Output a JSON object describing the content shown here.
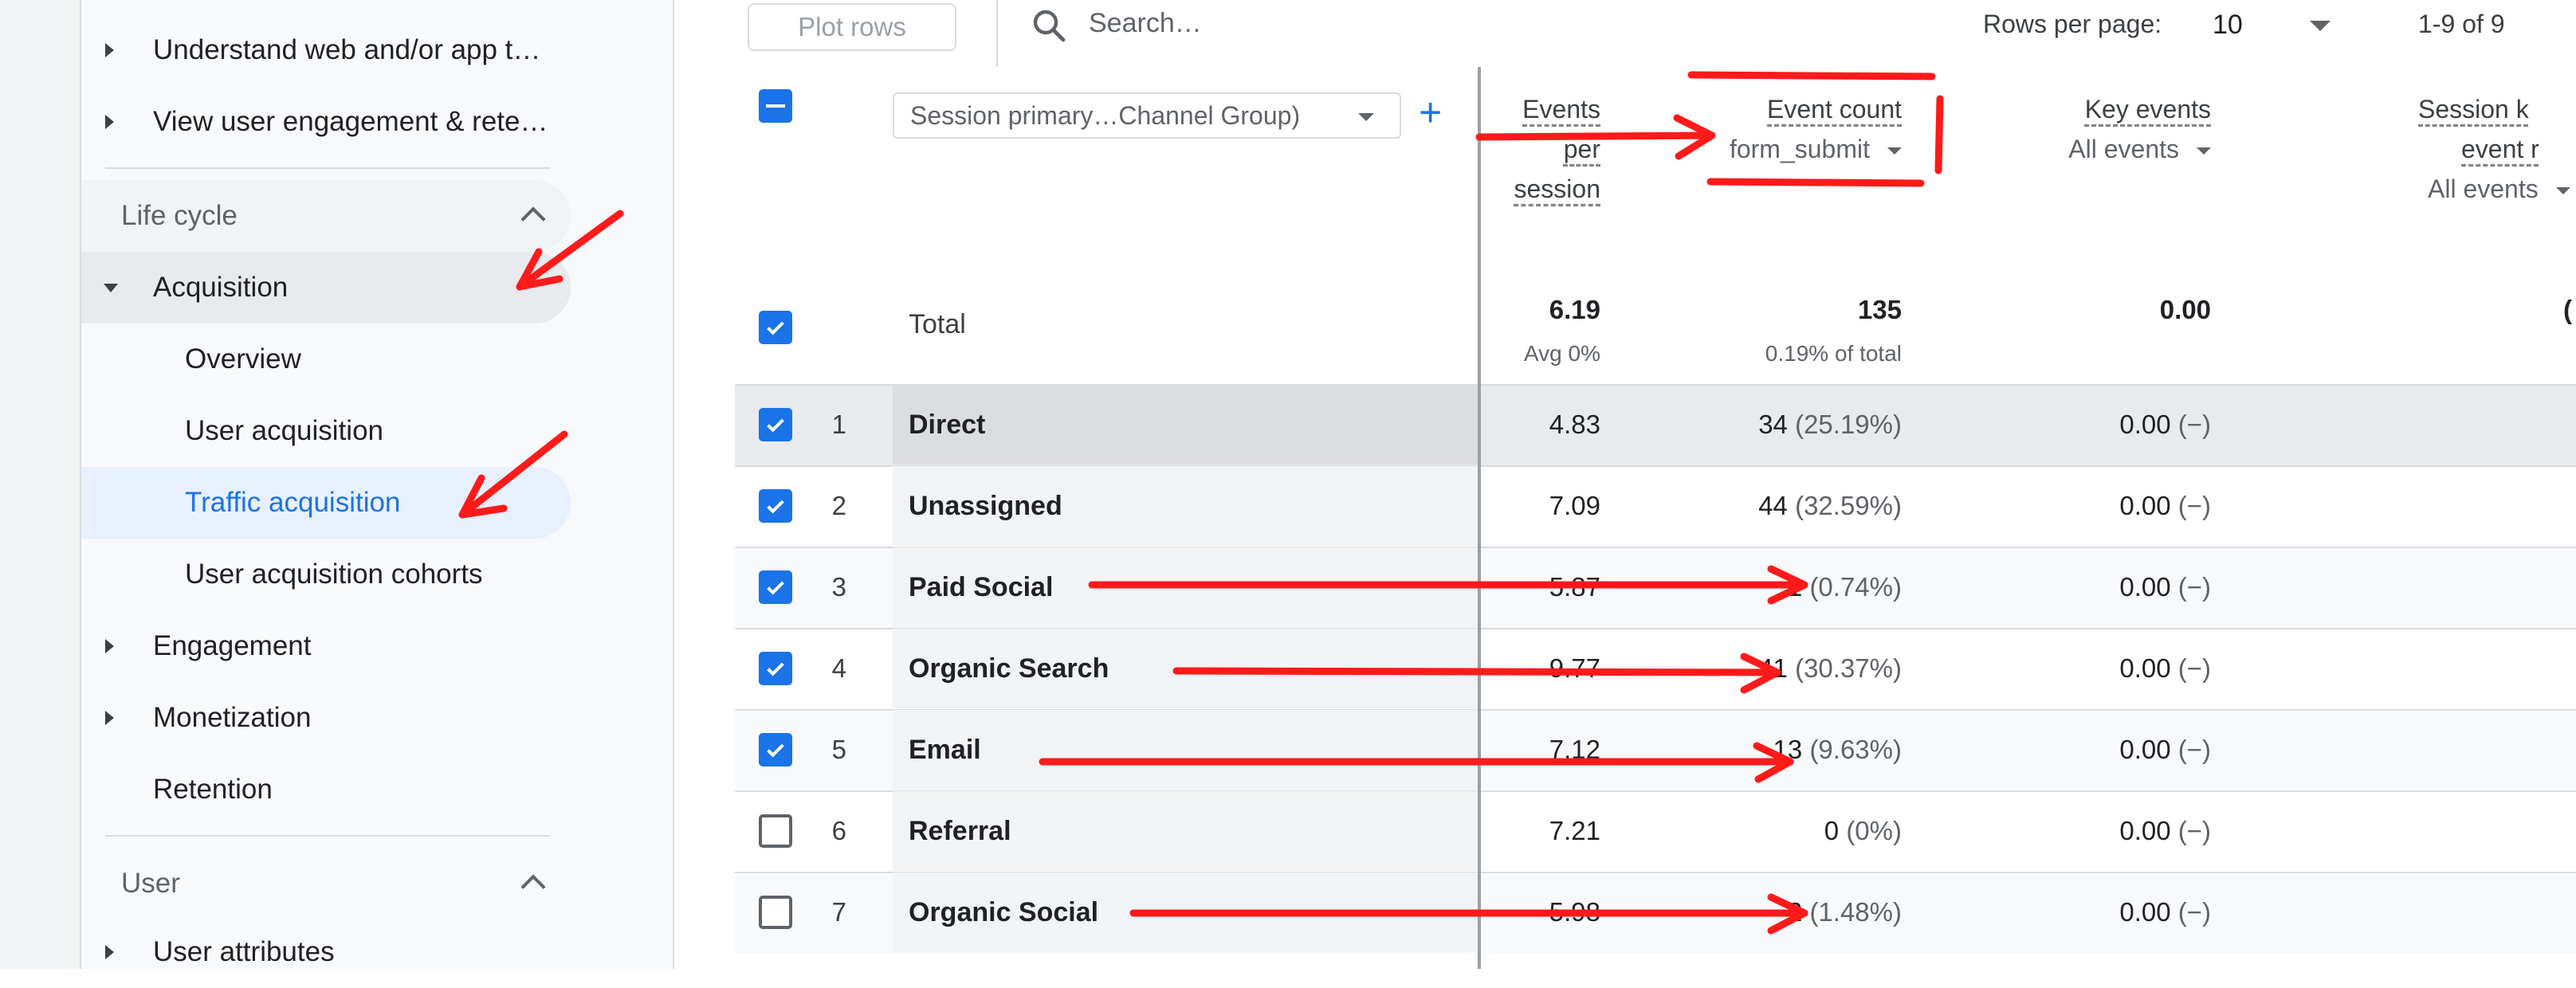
{
  "sidebar": {
    "top_items": [
      {
        "label": "Understand web and/or app t…"
      },
      {
        "label": "View user engagement & rete…"
      }
    ],
    "lifecycle": {
      "label": "Life cycle",
      "acquisition": {
        "label": "Acquisition",
        "children": [
          {
            "label": "Overview"
          },
          {
            "label": "User acquisition"
          },
          {
            "label": "Traffic acquisition",
            "active": true
          },
          {
            "label": "User acquisition cohorts"
          }
        ]
      },
      "engagement": "Engagement",
      "monetization": "Monetization",
      "retention": "Retention"
    },
    "user_section": {
      "label": "User",
      "attributes": "User attributes"
    }
  },
  "toolbar": {
    "plot_rows": "Plot rows",
    "search_placeholder": "Search…",
    "rows_per_page_label": "Rows per page:",
    "rows_per_page_value": "10",
    "page_range": "1-9 of 9"
  },
  "table": {
    "dimension_selector": "Session primary…Channel Group)",
    "headers": {
      "events_per_session": [
        "Events",
        "per",
        "session"
      ],
      "event_count": {
        "title": "Event count",
        "filter": "form_submit"
      },
      "key_events": {
        "title": "Key events",
        "filter": "All events"
      },
      "session_key_event_rate": {
        "title": "Session k",
        "title2": "event r",
        "filter": "All events"
      }
    },
    "total": {
      "label": "Total",
      "events_per_session": "6.19",
      "events_per_session_sub": "Avg 0%",
      "event_count": "135",
      "event_count_sub": "0.19% of total",
      "key_events": "0.00",
      "partial": "("
    },
    "rows": [
      {
        "idx": "1",
        "name": "Direct",
        "eps": "4.83",
        "count": "34",
        "pct": "(25.19%)",
        "key": "0.00",
        "key_pct": "(−)",
        "checked": true
      },
      {
        "idx": "2",
        "name": "Unassigned",
        "eps": "7.09",
        "count": "44",
        "pct": "(32.59%)",
        "key": "0.00",
        "key_pct": "(−)",
        "checked": true
      },
      {
        "idx": "3",
        "name": "Paid Social",
        "eps": "5.87",
        "count": "1",
        "pct": "(0.74%)",
        "key": "0.00",
        "key_pct": "(−)",
        "checked": true
      },
      {
        "idx": "4",
        "name": "Organic Search",
        "eps": "9.77",
        "count": "41",
        "pct": "(30.37%)",
        "key": "0.00",
        "key_pct": "(−)",
        "checked": true
      },
      {
        "idx": "5",
        "name": "Email",
        "eps": "7.12",
        "count": "13",
        "pct": "(9.63%)",
        "key": "0.00",
        "key_pct": "(−)",
        "checked": true
      },
      {
        "idx": "6",
        "name": "Referral",
        "eps": "7.21",
        "count": "0",
        "pct": "(0%)",
        "key": "0.00",
        "key_pct": "(−)",
        "checked": false
      },
      {
        "idx": "7",
        "name": "Organic Social",
        "eps": "5.98",
        "count": "2",
        "pct": "(1.48%)",
        "key": "0.00",
        "key_pct": "(−)",
        "checked": false
      }
    ]
  },
  "colors": {
    "accent": "#1a73e8",
    "annotation": "#ff1a1a",
    "active_nav_bg": "#e8f0fe"
  },
  "icons": [
    "search-icon",
    "checkbox-icon",
    "plus-icon",
    "caret-down-icon",
    "chevron-up-icon",
    "caret-right-icon"
  ]
}
